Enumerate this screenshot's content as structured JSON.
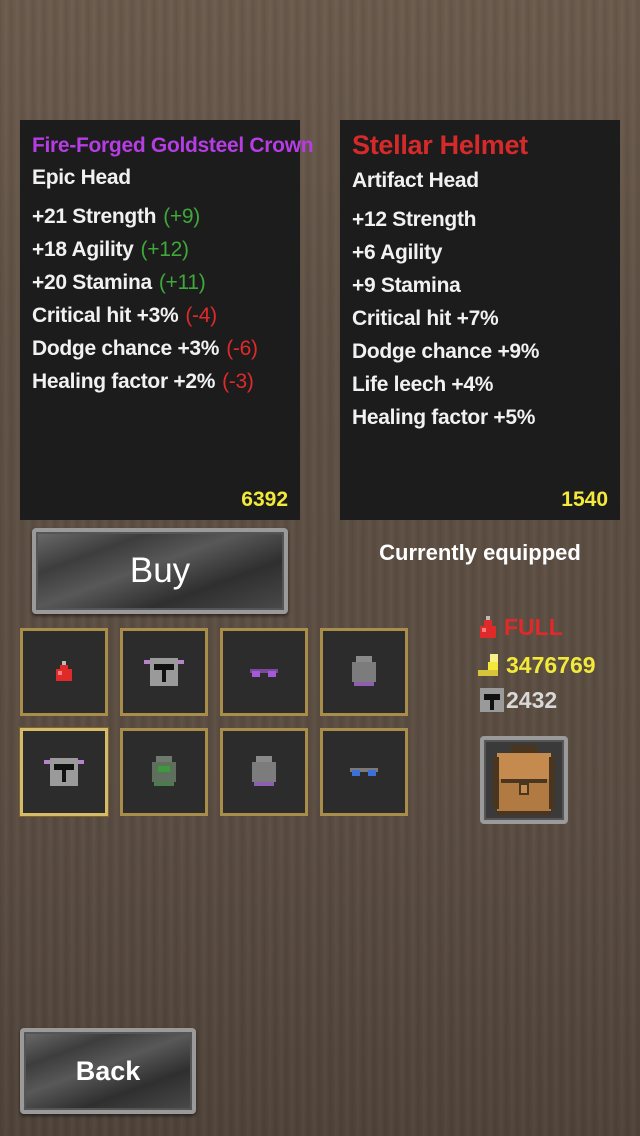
{
  "left_item": {
    "name": "Fire-Forged Goldsteel Crown",
    "type": "Epic Head",
    "stats": [
      {
        "label": "+21 Strength",
        "diff": "(+9)",
        "diff_color": "#3fa83a"
      },
      {
        "label": "+18 Agility",
        "diff": "(+12)",
        "diff_color": "#3fa83a"
      },
      {
        "label": "+20 Stamina",
        "diff": "(+11)",
        "diff_color": "#3fa83a"
      },
      {
        "label": "Critical hit +3%",
        "diff": "(-4)",
        "diff_color": "#e02a2a"
      },
      {
        "label": "Dodge chance +3%",
        "diff": "(-6)",
        "diff_color": "#e02a2a"
      },
      {
        "label": "Healing factor +2%",
        "diff": "(-3)",
        "diff_color": "#e02a2a"
      }
    ],
    "price": "6392",
    "name_color": "#b63ce3"
  },
  "right_item": {
    "name": "Stellar Helmet",
    "type": "Artifact Head",
    "stats": [
      {
        "label": "+12 Strength"
      },
      {
        "label": "+6 Agility"
      },
      {
        "label": "+9 Stamina"
      },
      {
        "label": "Critical hit +7%"
      },
      {
        "label": "Dodge chance +9%"
      },
      {
        "label": "Life leech +4%"
      },
      {
        "label": "Healing factor +5%"
      }
    ],
    "price": "1540",
    "name_color": "#d62a2a"
  },
  "buttons": {
    "buy": "Buy",
    "back": "Back"
  },
  "equipped_label": "Currently equipped",
  "resources": {
    "potions": "FULL",
    "gold": "3476769",
    "helmets": "2432"
  },
  "inventory": [
    {
      "icon": "red-potion-icon"
    },
    {
      "icon": "horned-helmet-icon"
    },
    {
      "icon": "purple-goggles-icon"
    },
    {
      "icon": "gray-hood-icon"
    },
    {
      "icon": "horned-helmet-icon",
      "selected": true
    },
    {
      "icon": "green-hood-icon"
    },
    {
      "icon": "gray-hood-icon"
    },
    {
      "icon": "blue-goggles-icon"
    }
  ]
}
